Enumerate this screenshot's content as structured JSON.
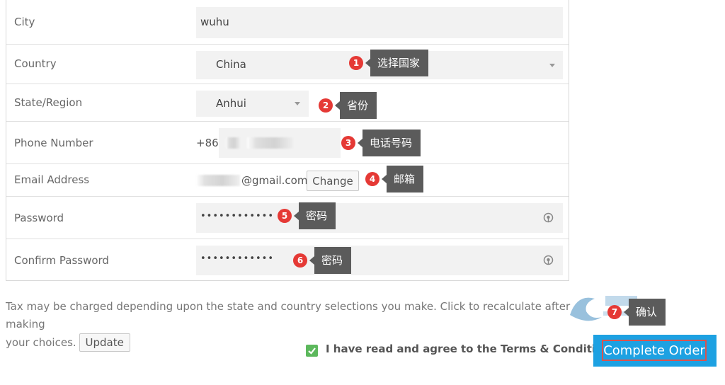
{
  "form": {
    "city": {
      "label": "City",
      "value": "wuhu"
    },
    "country": {
      "label": "Country",
      "value": "China"
    },
    "state": {
      "label": "State/Region",
      "value": "Anhui"
    },
    "phone": {
      "label": "Phone Number",
      "prefix": "+86"
    },
    "email": {
      "label": "Email Address",
      "value": "@gmail.com",
      "change_label": "Change"
    },
    "password": {
      "label": "Password",
      "value": "••••••••••••"
    },
    "confirm_password": {
      "label": "Confirm Password",
      "value": "••••••••••••"
    }
  },
  "callouts": [
    {
      "num": "1",
      "text": "选择国家"
    },
    {
      "num": "2",
      "text": "省份"
    },
    {
      "num": "3",
      "text": "电话号码"
    },
    {
      "num": "4",
      "text": "邮箱"
    },
    {
      "num": "5",
      "text": "密码"
    },
    {
      "num": "6",
      "text": "密码"
    },
    {
      "num": "7",
      "text": "确认"
    }
  ],
  "tax_note": {
    "line1": "Tax may be charged depending upon the state and country selections you make. Click to recalculate after making",
    "line2": "your choices.",
    "update_label": "Update"
  },
  "agree": {
    "text": "I have read and agree to the Terms & Conditions"
  },
  "complete_order_label": "Complete Order",
  "colors": {
    "accent": "#1da1e2",
    "callout_red": "#e53935",
    "tooltip": "#5b5b5b",
    "check": "#5cb85c"
  }
}
